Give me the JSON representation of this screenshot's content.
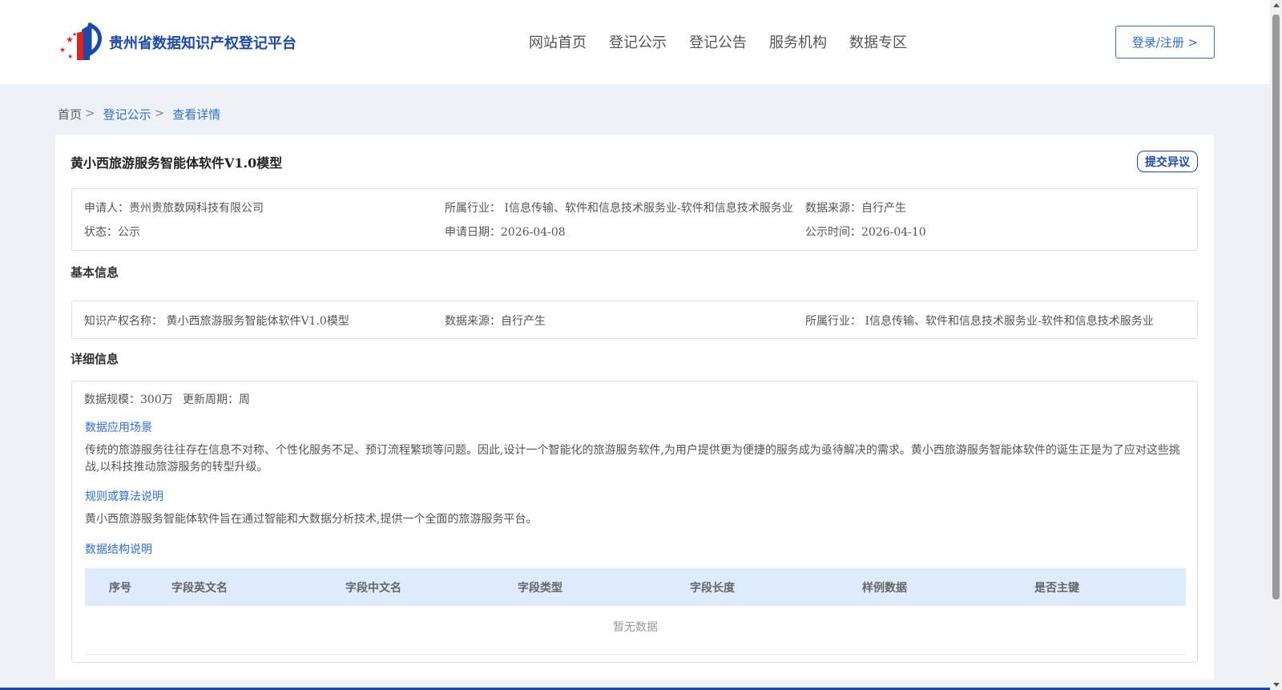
{
  "header": {
    "site_title": "贵州省数据知识产权登记平台",
    "nav": [
      "网站首页",
      "登记公示",
      "登记公告",
      "服务机构",
      "数据专区"
    ],
    "login_label": "登录/注册 >"
  },
  "breadcrumb": {
    "home": "首页",
    "sep1": ">",
    "level1": "登记公示",
    "sep2": ">",
    "level2": "查看详情"
  },
  "detail": {
    "title": "黄小西旅游服务智能体软件V1.0模型",
    "objection_label": "提交异议",
    "summary": {
      "applicant": "申请人：贵州贵旅数网科技有限公司",
      "industry": "所属行业： I信息传输、软件和信息技术服务业-软件和信息技术服务业",
      "data_source": "数据来源：自行产生",
      "status": "状态：公示",
      "apply_date": "申请日期：2026-04-08",
      "publish_date": "公示时间：2026-04-10"
    },
    "basic_section_title": "基本信息",
    "basic": {
      "ip_name": "知识产权名称： 黄小西旅游服务智能体软件V1.0模型",
      "data_source": "数据来源：自行产生",
      "industry": "所属行业： I信息传输、软件和信息技术服务业-软件和信息技术服务业"
    },
    "detail_section_title": "详细信息",
    "info": {
      "scale": "数据规模：300万",
      "update_cycle": "更新周期：周",
      "scenario_title": "数据应用场景",
      "scenario_text": "传统的旅游服务往往存在信息不对称、个性化服务不足、预订流程繁琐等问题。因此,设计一个智能化的旅游服务软件,为用户提供更为便捷的服务成为亟待解决的需求。黄小西旅游服务智能体软件的诞生正是为了应对这些挑战,以科技推动旅游服务的转型升级。",
      "algorithm_title": "规则或算法说明",
      "algorithm_text": "黄小西旅游服务智能体软件旨在通过智能和大数据分析技术,提供一个全面的旅游服务平台。",
      "structure_title": "数据结构说明"
    },
    "table": {
      "columns": [
        "序号",
        "字段英文名",
        "字段中文名",
        "字段类型",
        "字段长度",
        "样例数据",
        "是否主键"
      ],
      "empty_text": "暂无数据"
    }
  }
}
